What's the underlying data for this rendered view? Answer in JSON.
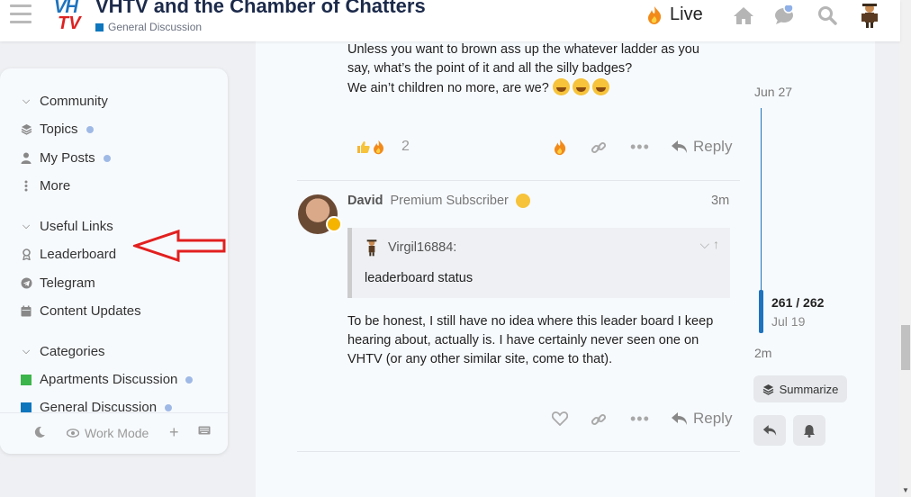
{
  "header": {
    "logo_top": "VH",
    "logo_bottom": "TV",
    "title": "VHTV and the Chamber of Chatters",
    "category": "General Discussion",
    "category_color": "#0e76bd",
    "live_label": "Live",
    "icons": [
      "hamburger-icon",
      "fire-icon",
      "home-icon",
      "chat-icon",
      "search-icon",
      "user-avatar"
    ]
  },
  "sidebar": {
    "sections": [
      {
        "label": "Community",
        "items": [
          {
            "label": "Topics",
            "icon": "layers-icon",
            "dot": true
          },
          {
            "label": "My Posts",
            "icon": "user-icon",
            "dot": true
          },
          {
            "label": "More",
            "icon": "ellipsis-vertical-icon",
            "dot": false
          }
        ]
      },
      {
        "label": "Useful Links",
        "items": [
          {
            "label": "Leaderboard",
            "icon": "award-icon",
            "dot": false
          },
          {
            "label": "Telegram",
            "icon": "telegram-icon",
            "dot": false
          },
          {
            "label": "Content Updates",
            "icon": "calendar-icon",
            "dot": false
          }
        ]
      },
      {
        "label": "Categories",
        "items": [
          {
            "label": "Apartments Discussion",
            "color": "#3cb54a",
            "dot": true
          },
          {
            "label": "General Discussion",
            "color": "#0e76bd",
            "dot": true
          }
        ]
      }
    ],
    "footer": {
      "work_mode_label": "Work Mode"
    }
  },
  "posts": [
    {
      "lines": [
        "Unless you want to brown ass up the whatever ladder as you",
        "say, what’s the point of it and all the silly badges?",
        "We ain’t children no more, are we?"
      ],
      "reactions_count": "2",
      "reply_label": "Reply"
    },
    {
      "author": "David",
      "flair": "Premium Subscriber",
      "time": "3m",
      "quote": {
        "user": "Virgil16884:",
        "text": "leaderboard status"
      },
      "lines": [
        "To be honest, I still have no idea where this leader board I keep",
        "hearing about, actually is. I have certainly never seen one on",
        "VHTV (or any other similar site, come to that)."
      ],
      "reply_label": "Reply"
    }
  ],
  "timeline": {
    "start_date": "Jun 27",
    "position": "261 / 262",
    "position_date": "Jul 19",
    "end_label": "2m",
    "summarize_label": "Summarize"
  }
}
